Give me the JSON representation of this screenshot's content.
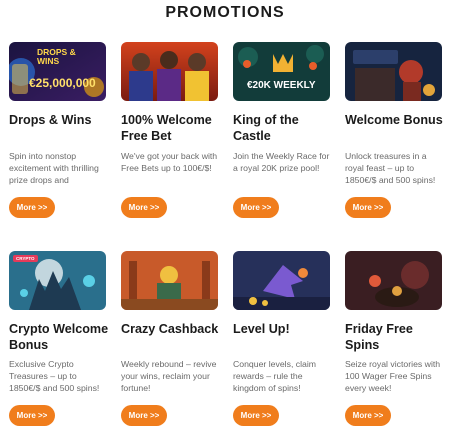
{
  "page": {
    "title": "PROMOTIONS"
  },
  "colors": {
    "accent": "#f07d1c",
    "title": "#1b1b1b",
    "desc": "#6a6a6a"
  },
  "promotions": [
    {
      "title": "Drops & Wins",
      "description": "Spin into nonstop excitement with thrilling prize drops and",
      "button": "More >>",
      "image": {
        "top_text": "DROPS & WINS",
        "amount": "€25,000,000"
      }
    },
    {
      "title": "100% Welcome Free Bet",
      "description": "We've got your back with Free Bets up to 100€/$!",
      "button": "More >>"
    },
    {
      "title": "King of the Castle",
      "description": "Join the Weekly Race for a royal 20K prize pool!",
      "button": "More >>",
      "image": {
        "amount": "€20K WEEKLY"
      }
    },
    {
      "title": "Welcome Bonus",
      "description": "Unlock treasures in a royal feast – up to 1850€/$ and 500 spins!",
      "button": "More >>"
    },
    {
      "title": "Crypto Welcome Bonus",
      "description": "Exclusive Crypto Treasures – up to 1850€/$ and 500 spins!",
      "button": "More >>",
      "image": {
        "badge": "CRYPTO"
      }
    },
    {
      "title": "Crazy Cashback",
      "description": "Weekly rebound – revive your wins, reclaim your fortune!",
      "button": "More >>"
    },
    {
      "title": "Level Up!",
      "description": "Conquer levels, claim rewards – rule the kingdom of spins!",
      "button": "More >>"
    },
    {
      "title": "Friday Free Spins",
      "description": "Seize royal victories with 100 Wager Free Spins every week!",
      "button": "More >>"
    }
  ]
}
